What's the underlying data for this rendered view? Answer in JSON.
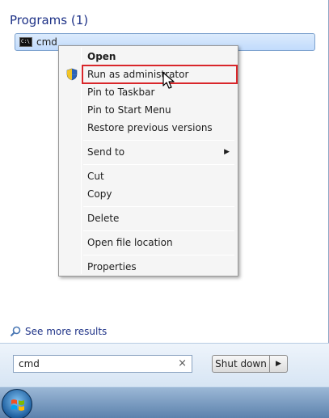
{
  "start_menu": {
    "section_header": "Programs (1)",
    "results": [
      {
        "label": "cmd",
        "icon": "command-prompt-icon",
        "icon_text": "C:\\"
      }
    ],
    "see_more": "See more results",
    "search": {
      "value": "cmd",
      "clear": "×"
    },
    "shutdown": {
      "label": "Shut down",
      "arrow": "▶"
    }
  },
  "context_menu": {
    "items": [
      {
        "label": "Open",
        "bold": true
      },
      {
        "label": "Run as administrator",
        "icon": "uac-shield-icon",
        "highlighted": true
      },
      {
        "label": "Pin to Taskbar"
      },
      {
        "label": "Pin to Start Menu"
      },
      {
        "label": "Restore previous versions"
      },
      {
        "label": "Send to",
        "submenu": true,
        "arrow": "▶"
      },
      {
        "label": "Cut"
      },
      {
        "label": "Copy"
      },
      {
        "label": "Delete"
      },
      {
        "label": "Open file location"
      },
      {
        "label": "Properties"
      }
    ]
  },
  "colors": {
    "highlight_border": "#d9262a",
    "header_text": "#1e3287"
  }
}
